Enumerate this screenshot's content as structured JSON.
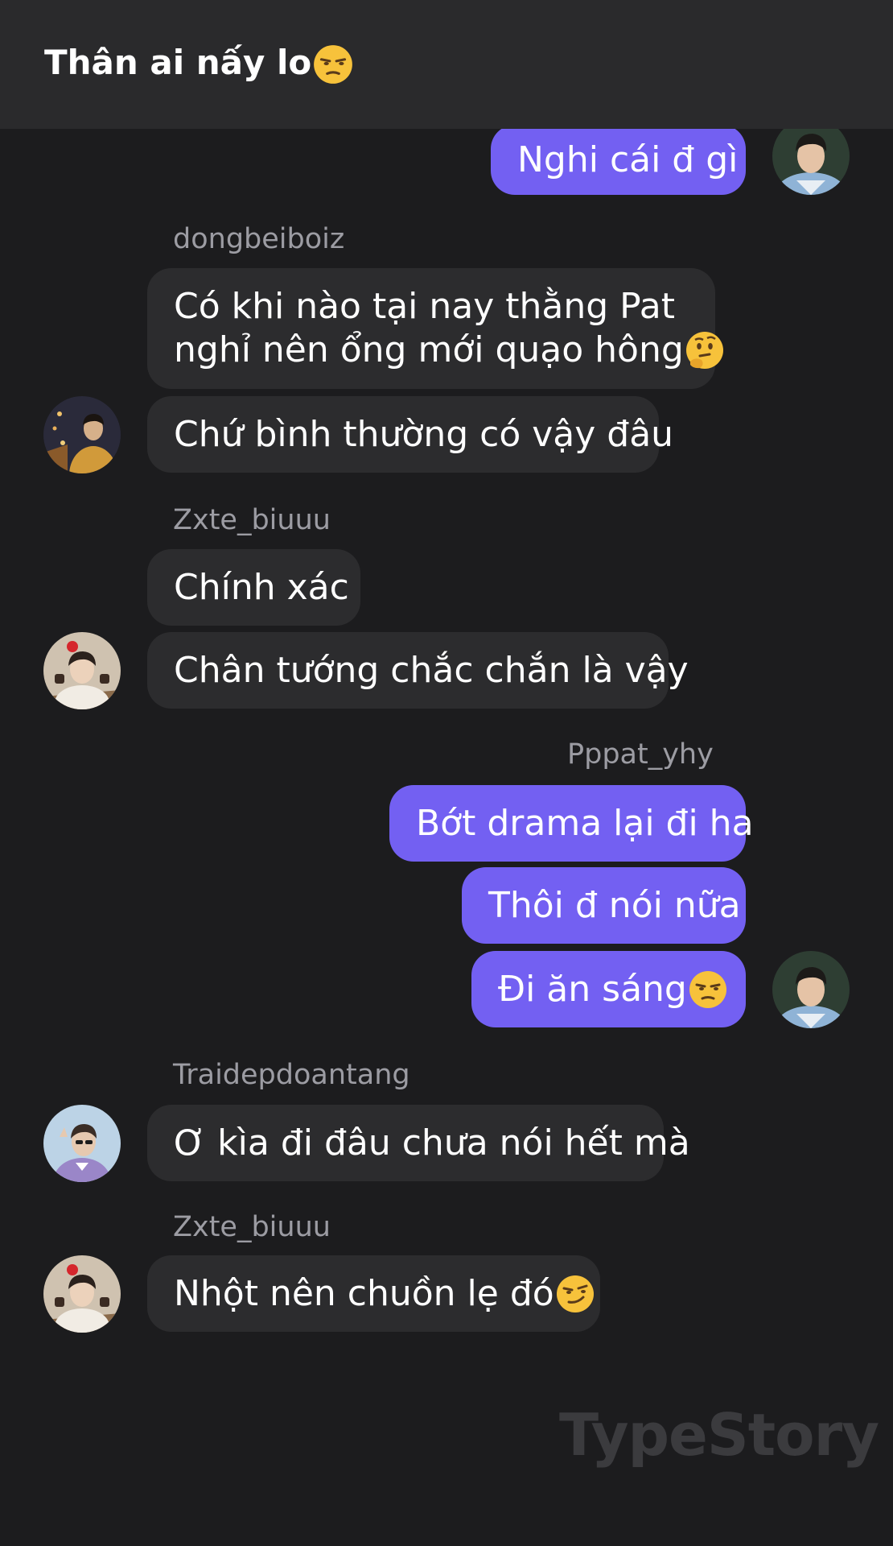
{
  "header": {
    "title": "Thân ai nấy lo",
    "title_emoji": "unamused-face-emoji"
  },
  "messages": [
    {
      "side": "out",
      "text": "Nghi cái đ gì"
    },
    {
      "side": "in",
      "sender": "dongbeiboiz",
      "lines": [
        "Có khi nào tại nay thằng Pat",
        "nghỉ nên ổng mới quạo hông"
      ],
      "emoji": "thinking-face-emoji"
    },
    {
      "side": "in",
      "text": "Chứ bình thường có vậy đâu"
    },
    {
      "side": "in",
      "sender": "Zxte_biuuu",
      "text": "Chính xác"
    },
    {
      "side": "in",
      "text": "Chân tướng chắc chắn là vậy"
    },
    {
      "side": "out",
      "sender": "Pppat_yhy",
      "text": "Bớt drama lại đi ha"
    },
    {
      "side": "out",
      "text": "Thôi đ nói nữa"
    },
    {
      "side": "out",
      "text": "Đi ăn sáng",
      "emoji": "unamused-face-emoji"
    },
    {
      "side": "in",
      "sender": "Traidepdoantang",
      "text": "Ơ kìa đi đâu chưa nói hết mà"
    },
    {
      "side": "in",
      "sender": "Zxte_biuuu",
      "text": "Nhột nên chuồn lẹ đó",
      "emoji": "smirking-face-emoji"
    }
  ],
  "watermark": "TypeStory",
  "colors": {
    "background": "#1c1c1e",
    "header": "#2a2a2c",
    "incoming_bubble": "#2c2c2e",
    "outgoing_bubble": "#7360f2",
    "sender_name": "#9c9ca3"
  }
}
